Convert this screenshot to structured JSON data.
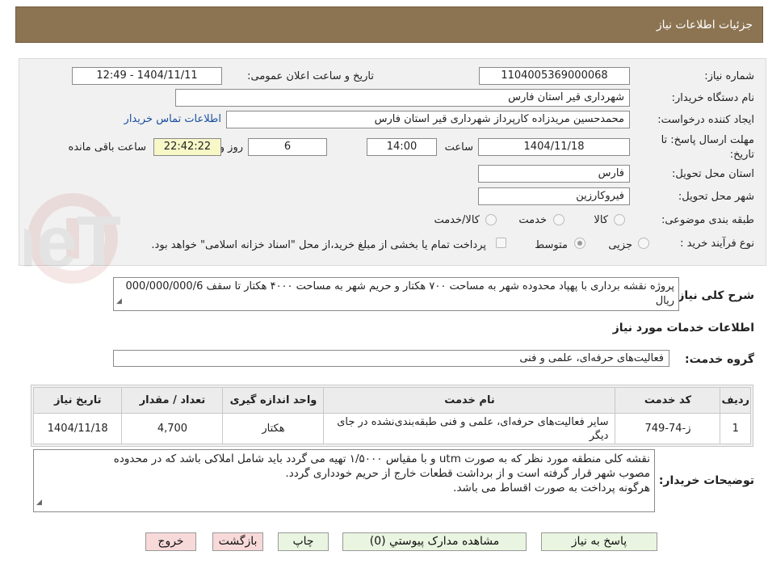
{
  "header": {
    "title": "جزئیات اطلاعات نیاز"
  },
  "fields": {
    "need_number_label": "شماره نیاز:",
    "need_number": "1104005369000068",
    "announce_label": "تاریخ و ساعت اعلان عمومی:",
    "announce_value": "1404/11/11 - 12:49",
    "buyer_org_label": "نام دستگاه خریدار:",
    "buyer_org": "شهرداری قیر استان فارس",
    "creator_label": "ایجاد کننده درخواست:",
    "creator": "محمدحسین مریدزاده کارپرداز شهرداری قیر استان فارس",
    "contact_link": "اطلاعات تماس خریدار",
    "deadline_label": "مهلت ارسال پاسخ: تا تاریخ:",
    "deadline_date": "1404/11/18",
    "time_label": "ساعت",
    "deadline_time": "14:00",
    "days": "6",
    "days_label": "روز و",
    "remaining": "22:42:22",
    "remaining_label": "ساعت باقی مانده",
    "province_label": "استان محل تحویل:",
    "province": "فارس",
    "city_label": "شهر محل تحویل:",
    "city": "فیروکارزین",
    "category_label": "طبقه بندی موضوعی:",
    "category_options": [
      "کالا",
      "خدمت",
      "کالا/خدمت"
    ],
    "category_selected": "خدمت",
    "process_label": "نوع فرآیند خرید :",
    "process_options": [
      "جزیی",
      "متوسط"
    ],
    "process_selected": "متوسط",
    "payment_note": "پرداخت تمام یا بخشی از مبلغ خرید،از محل \"اسناد خزانه اسلامی\" خواهد بود."
  },
  "summary": {
    "label": "شرح کلی نیاز:",
    "text": "پروژه نقشه برداری با پهپاد محدوده شهر به مساحت ۷۰۰ هکتار و حریم شهر به مساحت ۴۰۰۰ هکتار تا سقف 000/000/000/6 ریال"
  },
  "services": {
    "section_title": "اطلاعات خدمات مورد نیاز",
    "group_label": "گروه خدمت:",
    "group_value": "فعالیت‌های حرفه‌ای، علمی و فنی",
    "columns": [
      "ردیف",
      "کد خدمت",
      "نام خدمت",
      "واحد اندازه گیری",
      "تعداد / مقدار",
      "تاریخ نیاز"
    ],
    "rows": [
      [
        "1",
        "ز-74-749",
        "سایر فعالیت‌های حرفه‌ای، علمی و فنی طبقه‌بندی‌نشده در جای دیگر",
        "هکتار",
        "4,700",
        "1404/11/18"
      ]
    ]
  },
  "buyer_notes": {
    "label": "توضیحات خریدار:",
    "lines": [
      "نقشه کلی منطقه مورد نظر که به صورت utm و با مقیاس ۱/۵۰۰۰ تهیه می گردد باید شامل املاکی باشد که در محدوده",
      "مصوب شهر قرار گرفته است و از برداشت قطعات خارج از حریم خودداری گردد.",
      "هرگونه پرداخت به صورت اقساط  می باشد."
    ]
  },
  "buttons": {
    "reply": "پاسخ به نیاز",
    "attachments": "مشاهده مدارک پیوستي (0)",
    "print": "چاپ",
    "back": "بازگشت",
    "exit": "خروج"
  },
  "watermark": {
    "text": "AriaTender.neT"
  },
  "colors": {
    "header_bg": "#8c7452",
    "link": "#1a4fa0",
    "green_button": "#e9f5e0",
    "pink_button": "#f8d9d9",
    "remaining_bg": "#f7f7c8"
  }
}
